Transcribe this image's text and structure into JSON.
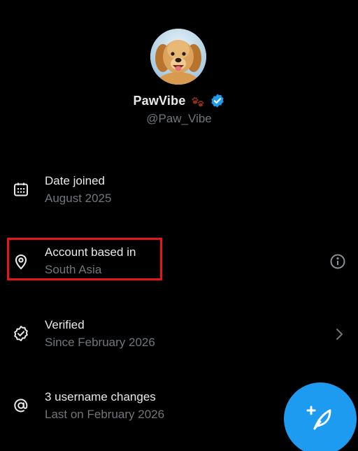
{
  "profile": {
    "display_name": "PawVibe",
    "handle": "@Paw_Vibe",
    "avatar_icon": "golden-retriever-avatar",
    "name_badges": [
      "paw-prints-icon",
      "verified-badge-icon"
    ]
  },
  "rows": [
    {
      "icon": "calendar-icon",
      "title": "Date joined",
      "subtitle": "August 2025",
      "trailing_icon": null
    },
    {
      "icon": "location-pin-icon",
      "title": "Account based in",
      "subtitle": "South Asia",
      "trailing_icon": "info-icon",
      "highlighted": true
    },
    {
      "icon": "verified-check-icon",
      "title": "Verified",
      "subtitle": "Since February 2026",
      "trailing_icon": "chevron-right-icon"
    },
    {
      "icon": "at-sign-icon",
      "title": "3 username changes",
      "subtitle": "Last on February 2026",
      "trailing_icon": null
    }
  ],
  "fab": {
    "icon": "compose-post-icon"
  },
  "colors": {
    "background": "#000000",
    "primary_text": "#e7e9ea",
    "secondary_text": "#71767b",
    "accent_blue": "#1d9bf0",
    "highlight_red": "#e8141c"
  }
}
